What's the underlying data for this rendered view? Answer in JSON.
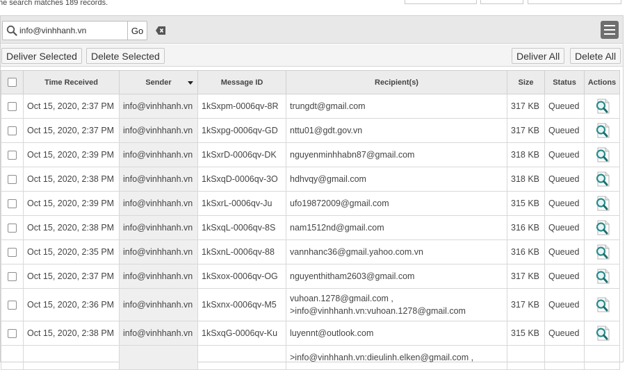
{
  "status_text": "he search matches 189 records.",
  "search": {
    "value": "info@vinhhanh.vn",
    "go_label": "Go"
  },
  "actions": {
    "deliver_selected": "Deliver Selected",
    "delete_selected": "Delete Selected",
    "deliver_all": "Deliver All",
    "delete_all": "Delete All"
  },
  "columns": {
    "time_received": "Time Received",
    "sender": "Sender",
    "message_id": "Message ID",
    "recipients": "Recipient(s)",
    "size": "Size",
    "status": "Status",
    "actions": "Actions"
  },
  "icons": {
    "search": "magnifier-icon",
    "clear": "clear-tag-icon",
    "menu": "list-menu-icon",
    "view": "view-message-icon",
    "sort": "sort-desc-icon"
  },
  "colors": {
    "header_bg": "#ececec",
    "sender_bg": "#efefef",
    "menu_btn": "#6e6e6e",
    "icon_teal": "#2a8a8a"
  },
  "rows": [
    {
      "time": "Oct 15, 2020, 2:37 PM",
      "sender": "info@vinhhanh.vn",
      "message_id": "1kSxpm-0006qv-8R",
      "recipient_1": "trungdt@gmail.com",
      "recipient_2": "",
      "size": "317 KB",
      "status": "Queued"
    },
    {
      "time": "Oct 15, 2020, 2:37 PM",
      "sender": "info@vinhhanh.vn",
      "message_id": "1kSxpg-0006qv-GD",
      "recipient_1": "nttu01@gdt.gov.vn",
      "recipient_2": "",
      "size": "317 KB",
      "status": "Queued"
    },
    {
      "time": "Oct 15, 2020, 2:39 PM",
      "sender": "info@vinhhanh.vn",
      "message_id": "1kSxrD-0006qv-DK",
      "recipient_1": "nguyenminhhabn87@gmail.com",
      "recipient_2": "",
      "size": "318 KB",
      "status": "Queued"
    },
    {
      "time": "Oct 15, 2020, 2:38 PM",
      "sender": "info@vinhhanh.vn",
      "message_id": "1kSxqD-0006qv-3O",
      "recipient_1": "hdhvqy@gmail.com",
      "recipient_2": "",
      "size": "318 KB",
      "status": "Queued"
    },
    {
      "time": "Oct 15, 2020, 2:39 PM",
      "sender": "info@vinhhanh.vn",
      "message_id": "1kSxrL-0006qv-Ju",
      "recipient_1": "ufo19872009@gmail.com",
      "recipient_2": "",
      "size": "315 KB",
      "status": "Queued"
    },
    {
      "time": "Oct 15, 2020, 2:38 PM",
      "sender": "info@vinhhanh.vn",
      "message_id": "1kSxqL-0006qv-8S",
      "recipient_1": "nam1512nd@gmail.com",
      "recipient_2": "",
      "size": "316 KB",
      "status": "Queued"
    },
    {
      "time": "Oct 15, 2020, 2:35 PM",
      "sender": "info@vinhhanh.vn",
      "message_id": "1kSxnL-0006qv-88",
      "recipient_1": "vannhanc36@gmail.yahoo.com.vn",
      "recipient_2": "",
      "size": "316 KB",
      "status": "Queued"
    },
    {
      "time": "Oct 15, 2020, 2:37 PM",
      "sender": "info@vinhhanh.vn",
      "message_id": "1kSxox-0006qv-OG",
      "recipient_1": "nguyenthitham2603@gmail.com",
      "recipient_2": "",
      "size": "317 KB",
      "status": "Queued"
    },
    {
      "time": "Oct 15, 2020, 2:36 PM",
      "sender": "info@vinhhanh.vn",
      "message_id": "1kSxnx-0006qv-M5",
      "recipient_1": "vuhoan.1278@gmail.com ,",
      "recipient_2": ">info@vinhhanh.vn:vuhoan.1278@gmail.com",
      "size": "317 KB",
      "status": "Queued"
    },
    {
      "time": "Oct 15, 2020, 2:38 PM",
      "sender": "info@vinhhanh.vn",
      "message_id": "1kSxqG-0006qv-Ku",
      "recipient_1": "luyennt@outlook.com",
      "recipient_2": "",
      "size": "315 KB",
      "status": "Queued"
    },
    {
      "time": "",
      "sender": "",
      "message_id": "",
      "recipient_1": ">info@vinhhanh.vn:dieulinh.elken@gmail.com ,",
      "recipient_2": "",
      "size": "",
      "status": ""
    }
  ]
}
